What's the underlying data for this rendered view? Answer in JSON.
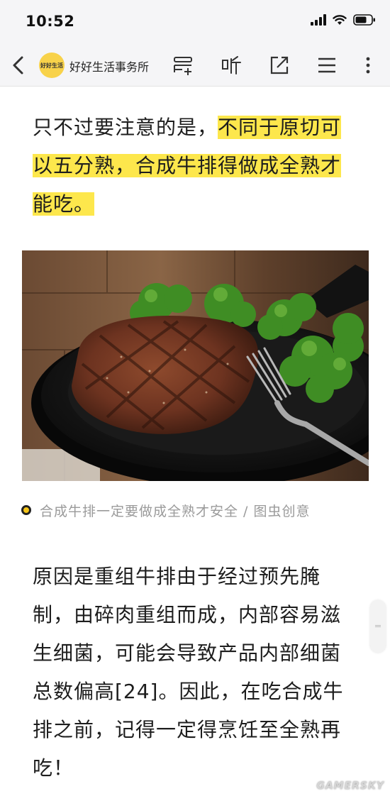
{
  "status_bar": {
    "time": "10:52"
  },
  "nav": {
    "account_name": "好好生活事务所",
    "logo_text": "好好生活"
  },
  "article": {
    "para1_plain": "只不过要注意的是，",
    "para1_highlight_1": "不同于原切可",
    "para1_highlight_2": "以五分熟，合成牛排得做成全熟才",
    "para1_highlight_3": "能吃。",
    "caption": "合成牛排一定要做成全熟才安全 / 图虫创意",
    "para2_lines": [
      "原因是重组牛排由于经过预先腌",
      "制，由碎肉重组而成，内部容易滋",
      "生细菌，可能会导致产品内部细菌",
      "总数偏高[24]。因此，在吃合成牛",
      "排之前，记得一定得烹饪至全熟再",
      "吃！"
    ]
  },
  "watermark": "GAMERSKY",
  "colors": {
    "highlight": "#fde74c",
    "logo_bg": "#f8d24a",
    "caption_text": "#9a9a9a"
  }
}
